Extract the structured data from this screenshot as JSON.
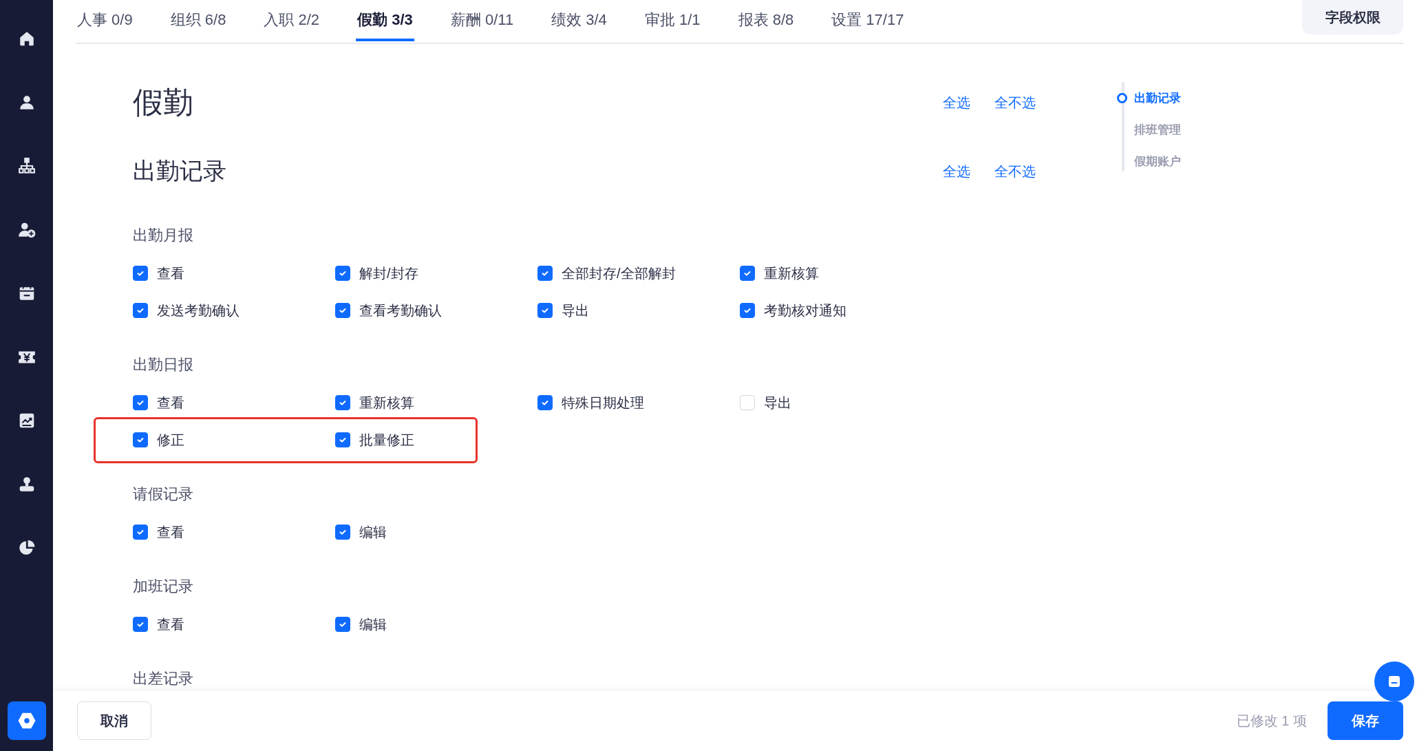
{
  "sidebar": {
    "items": [
      {
        "kind": "home",
        "selected": false
      },
      {
        "kind": "person",
        "selected": false
      },
      {
        "kind": "org",
        "selected": false
      },
      {
        "kind": "person-add",
        "selected": false
      },
      {
        "kind": "calendar",
        "selected": false
      },
      {
        "kind": "ticket",
        "selected": false
      },
      {
        "kind": "chart",
        "selected": false
      },
      {
        "kind": "stamp",
        "selected": false
      },
      {
        "kind": "pie",
        "selected": false
      },
      {
        "kind": "settings",
        "selected": true
      }
    ]
  },
  "tabs": [
    {
      "label": "人事 0/9",
      "selected": false
    },
    {
      "label": "组织 6/8",
      "selected": false
    },
    {
      "label": "入职 2/2",
      "selected": false
    },
    {
      "label": "假勤 3/3",
      "selected": true
    },
    {
      "label": "薪酬 0/11",
      "selected": false
    },
    {
      "label": "绩效 3/4",
      "selected": false
    },
    {
      "label": "审批 1/1",
      "selected": false
    },
    {
      "label": "报表 8/8",
      "selected": false
    },
    {
      "label": "设置 17/17",
      "selected": false
    }
  ],
  "field_permission_button": "字段权限",
  "page": {
    "title": "假勤",
    "select_all": "全选",
    "select_none": "全不选"
  },
  "section": {
    "title": "出勤记录",
    "select_all": "全选",
    "select_none": "全不选",
    "groups": [
      {
        "label": "出勤月报",
        "rows": [
          {
            "highlighted": false,
            "items": [
              {
                "label": "查看",
                "checked": true
              },
              {
                "label": "解封/封存",
                "checked": true
              },
              {
                "label": "全部封存/全部解封",
                "checked": true
              },
              {
                "label": "重新核算",
                "checked": true
              }
            ]
          },
          {
            "highlighted": false,
            "items": [
              {
                "label": "发送考勤确认",
                "checked": true
              },
              {
                "label": "查看考勤确认",
                "checked": true
              },
              {
                "label": "导出",
                "checked": true
              },
              {
                "label": "考勤核对通知",
                "checked": true
              }
            ]
          }
        ]
      },
      {
        "label": "出勤日报",
        "rows": [
          {
            "highlighted": false,
            "items": [
              {
                "label": "查看",
                "checked": true
              },
              {
                "label": "重新核算",
                "checked": true
              },
              {
                "label": "特殊日期处理",
                "checked": true
              },
              {
                "label": "导出",
                "checked": false
              }
            ]
          },
          {
            "highlighted": true,
            "items": [
              {
                "label": "修正",
                "checked": true
              },
              {
                "label": "批量修正",
                "checked": true
              }
            ]
          }
        ]
      },
      {
        "label": "请假记录",
        "rows": [
          {
            "highlighted": false,
            "items": [
              {
                "label": "查看",
                "checked": true
              },
              {
                "label": "编辑",
                "checked": true
              }
            ]
          }
        ]
      },
      {
        "label": "加班记录",
        "rows": [
          {
            "highlighted": false,
            "items": [
              {
                "label": "查看",
                "checked": true
              },
              {
                "label": "编辑",
                "checked": true
              }
            ]
          }
        ]
      },
      {
        "label": "出差记录"
      }
    ]
  },
  "anchor_nav": [
    {
      "label": "出勤记录",
      "selected": true
    },
    {
      "label": "排班管理",
      "selected": false
    },
    {
      "label": "假期账户",
      "selected": false
    }
  ],
  "footer": {
    "cancel": "取消",
    "status": "已修改 1 项",
    "save": "保存"
  }
}
